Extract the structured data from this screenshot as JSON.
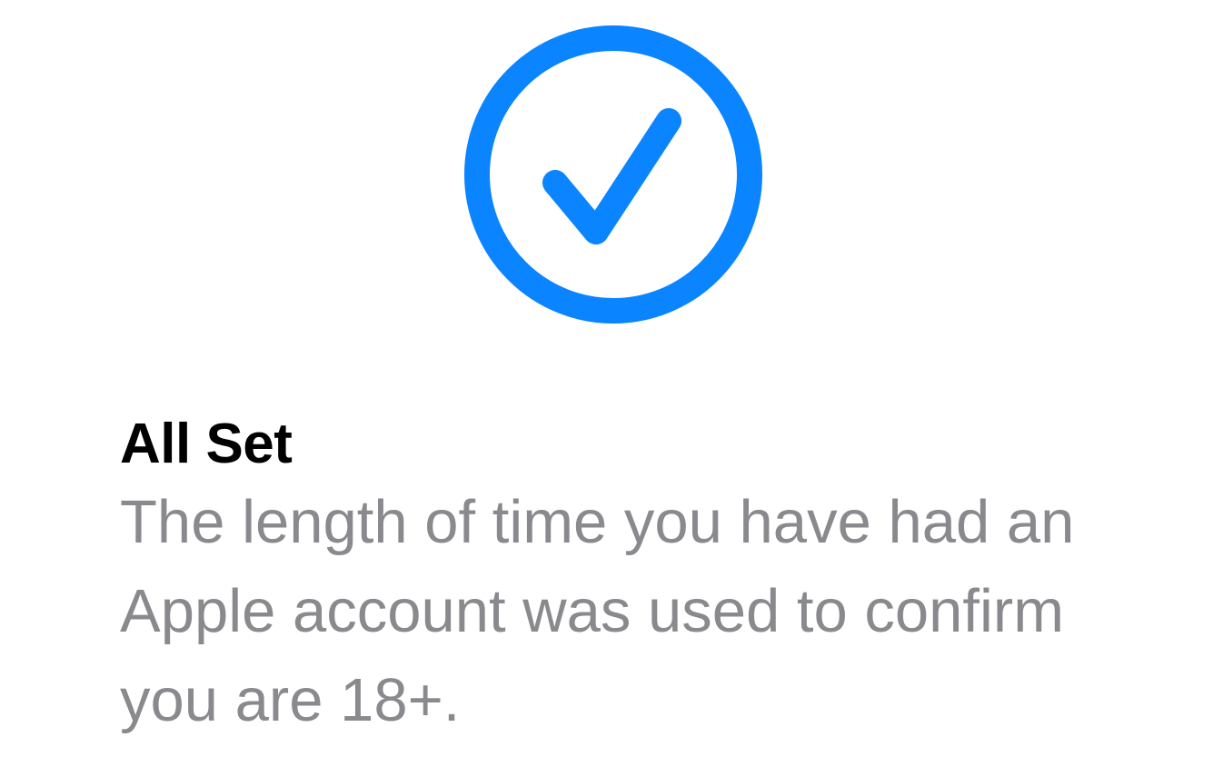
{
  "status": {
    "icon": "checkmark-circle-icon",
    "accent_color": "#0a84ff"
  },
  "title": "All Set",
  "message": "The length of time you have had an Apple account was used to confirm you are 18+."
}
